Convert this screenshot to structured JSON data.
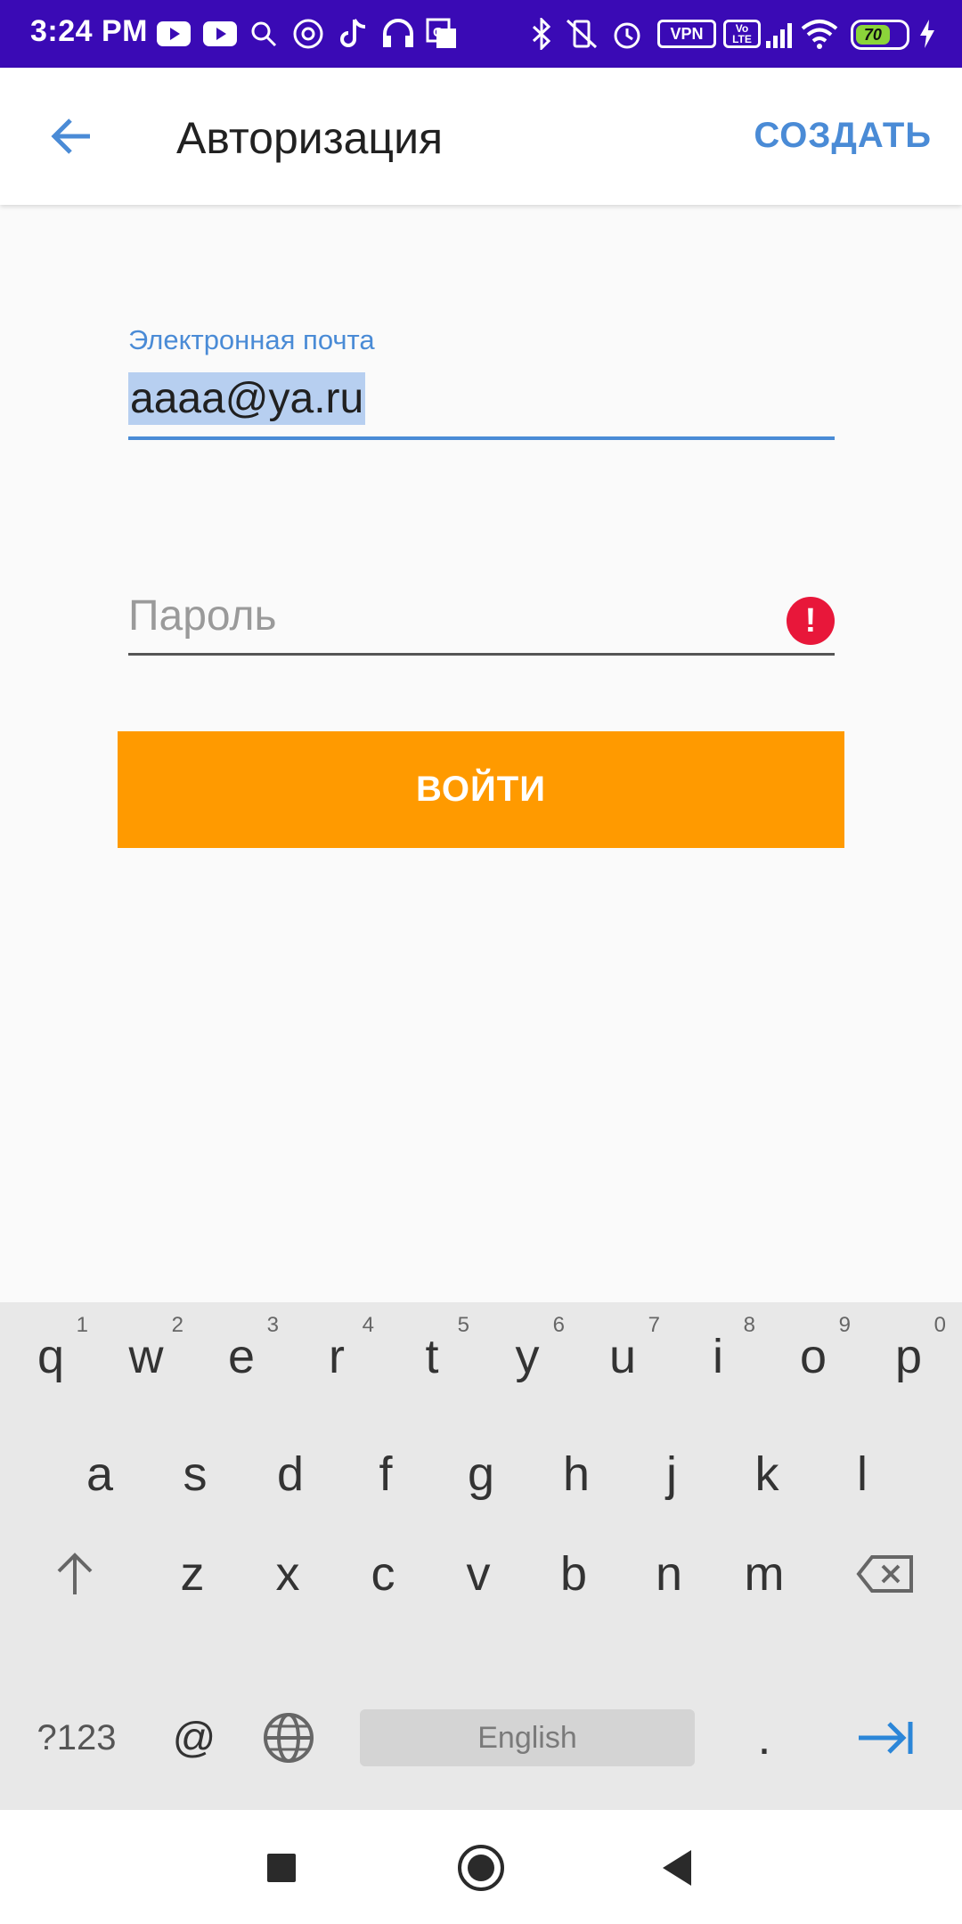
{
  "status_bar": {
    "time": "3:24 PM",
    "icons": [
      "youtube-icon",
      "youtube-icon",
      "search-icon",
      "at-sign-icon",
      "tiktok-icon",
      "headset-icon",
      "translate-icon",
      "bluetooth-icon",
      "vibrate-off-icon",
      "alarm-icon",
      "wifi-icon",
      "signal-icon",
      "charging-icon"
    ],
    "vpn_label": "VPN",
    "volte_label": "Vo LTE",
    "battery_level": "70"
  },
  "app_bar": {
    "title": "Авторизация",
    "action_label": "СОЗДАТЬ"
  },
  "form": {
    "email_label": "Электронная почта",
    "email_value": "aaaa@ya.ru",
    "password_placeholder": "Пароль",
    "error_icon": "!",
    "login_label": "ВОЙТИ"
  },
  "keyboard": {
    "row1": [
      "q",
      "w",
      "e",
      "r",
      "t",
      "y",
      "u",
      "i",
      "o",
      "p"
    ],
    "row1_hints": [
      "1",
      "2",
      "3",
      "4",
      "5",
      "6",
      "7",
      "8",
      "9",
      "0"
    ],
    "row2": [
      "a",
      "s",
      "d",
      "f",
      "g",
      "h",
      "j",
      "k",
      "l"
    ],
    "row3": [
      "z",
      "x",
      "c",
      "v",
      "b",
      "n",
      "m"
    ],
    "symbols_label": "?123",
    "at_label": "@",
    "space_label": "English",
    "period_label": "."
  },
  "colors": {
    "status_bar": "#3a0ab5",
    "accent": "#4a8bd6",
    "button": "#ff9a00",
    "error": "#e8173a"
  }
}
